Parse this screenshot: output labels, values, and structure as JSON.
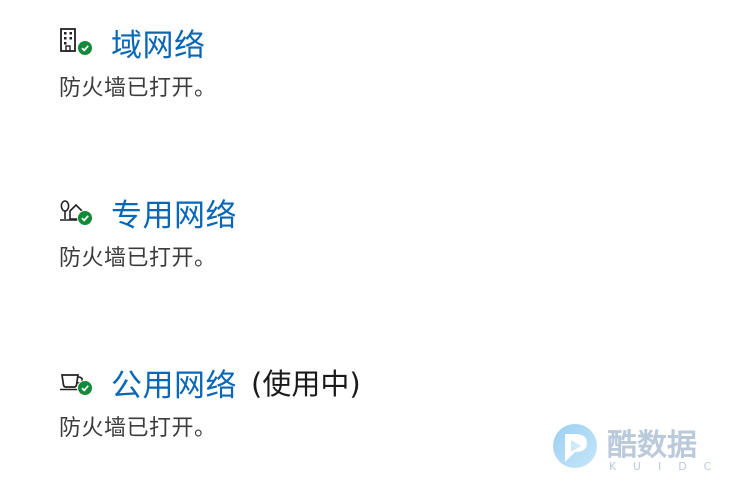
{
  "networks": [
    {
      "icon": "domain-building-icon",
      "name": "域网络",
      "in_use_label": "",
      "status": "防火墙已打开。"
    },
    {
      "icon": "private-home-icon",
      "name": "专用网络",
      "in_use_label": "",
      "status": "防火墙已打开。"
    },
    {
      "icon": "public-coffee-cup-icon",
      "name": "公用网络",
      "in_use_label": "(使用中)",
      "status": "防火墙已打开。"
    }
  ],
  "status_color": "#128a3a",
  "link_color": "#0a67b8",
  "watermark": {
    "text": "酷数据",
    "subtext": "KUIDC"
  }
}
